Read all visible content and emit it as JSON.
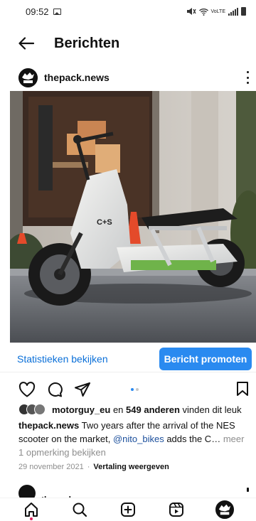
{
  "status_bar": {
    "time": "09:52",
    "network_label": "VoLTE"
  },
  "header": {
    "title": "Berichten"
  },
  "post": {
    "username": "thepack.news",
    "insights_label": "Statistieken bekijken",
    "promote_label": "Bericht promoten",
    "likes": {
      "first_user": "motorguy_eu",
      "connector": " en ",
      "count_text": "549 anderen",
      "suffix": " vinden dit leuk"
    },
    "caption": {
      "author": "thepack.news",
      "text_before": " Two years after the arrival of the NES scooter on the market, ",
      "mention": "@nito_bikes",
      "text_after": " adds the C…",
      "more": " meer"
    },
    "comments_link": "1 opmerking bekijken",
    "date": "29 november 2021",
    "separator": "·",
    "translate_label": "Vertaling weergeven",
    "image_overlay_text": "C+S"
  },
  "next_post": {
    "username": "thepack.news"
  },
  "colors": {
    "accent": "#2a8af0",
    "link": "#0a6fd8",
    "mention": "#1b4f9c",
    "muted": "#8e8e8e"
  },
  "icons": [
    "back-arrow-icon",
    "more-icon",
    "heart-icon",
    "comment-icon",
    "share-icon",
    "save-icon",
    "home-icon",
    "search-icon",
    "create-icon",
    "reels-icon",
    "profile-avatar-icon"
  ],
  "carousel": {
    "current": 1,
    "total": 2
  }
}
